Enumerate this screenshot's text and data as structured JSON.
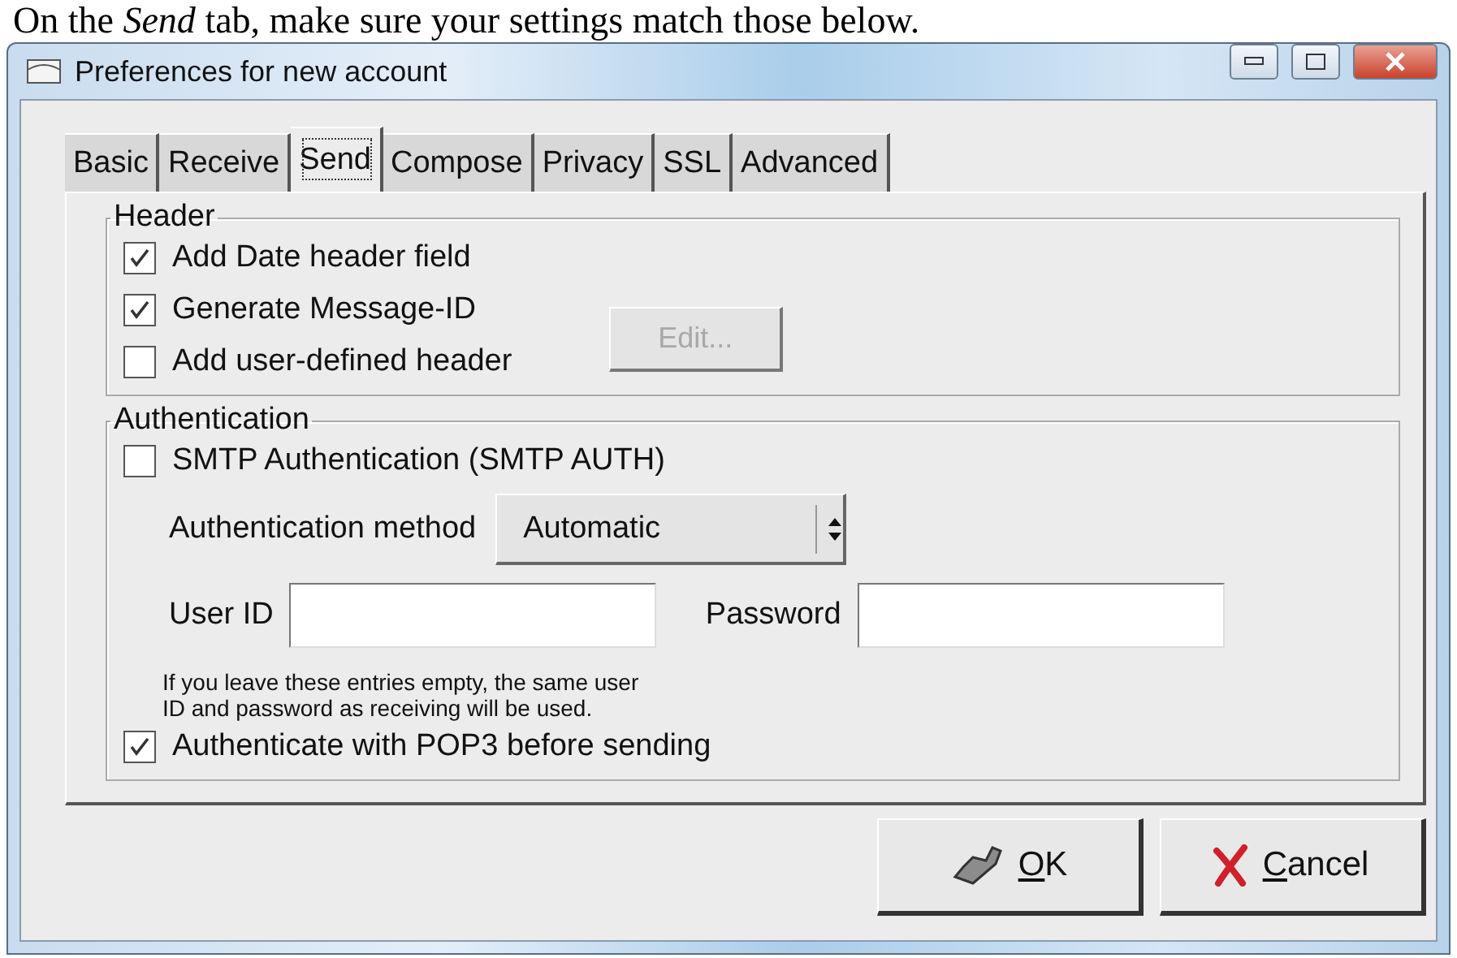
{
  "caption": {
    "before": "On the ",
    "emphasis": "Send",
    "after": " tab, make sure your settings match those below."
  },
  "window": {
    "title": "Preferences for new account"
  },
  "tabs": [
    {
      "label": "Basic",
      "selected": false
    },
    {
      "label": "Receive",
      "selected": false
    },
    {
      "label": "Send",
      "selected": true
    },
    {
      "label": "Compose",
      "selected": false
    },
    {
      "label": "Privacy",
      "selected": false
    },
    {
      "label": "SSL",
      "selected": false
    },
    {
      "label": "Advanced",
      "selected": false
    }
  ],
  "header_group": {
    "title": "Header",
    "options": [
      {
        "label": "Add Date header field",
        "checked": true
      },
      {
        "label": "Generate Message-ID",
        "checked": true
      },
      {
        "label": "Add user-defined header",
        "checked": false
      }
    ],
    "edit_button": {
      "label": "Edit...",
      "disabled": true
    }
  },
  "auth_group": {
    "title": "Authentication",
    "smtp_auth": {
      "label": "SMTP Authentication (SMTP AUTH)",
      "checked": false
    },
    "method": {
      "label": "Authentication method",
      "value": "Automatic"
    },
    "user_id": {
      "label": "User ID"
    },
    "password": {
      "label": "Password"
    },
    "note": "If you leave these entries empty, the same user\nID and password as receiving will be used.",
    "pop3": {
      "label": "Authenticate with POP3 before sending",
      "checked": true
    }
  },
  "buttons": [
    {
      "kind": "ok",
      "label": "OK"
    },
    {
      "kind": "cancel",
      "label": "Cancel"
    }
  ]
}
